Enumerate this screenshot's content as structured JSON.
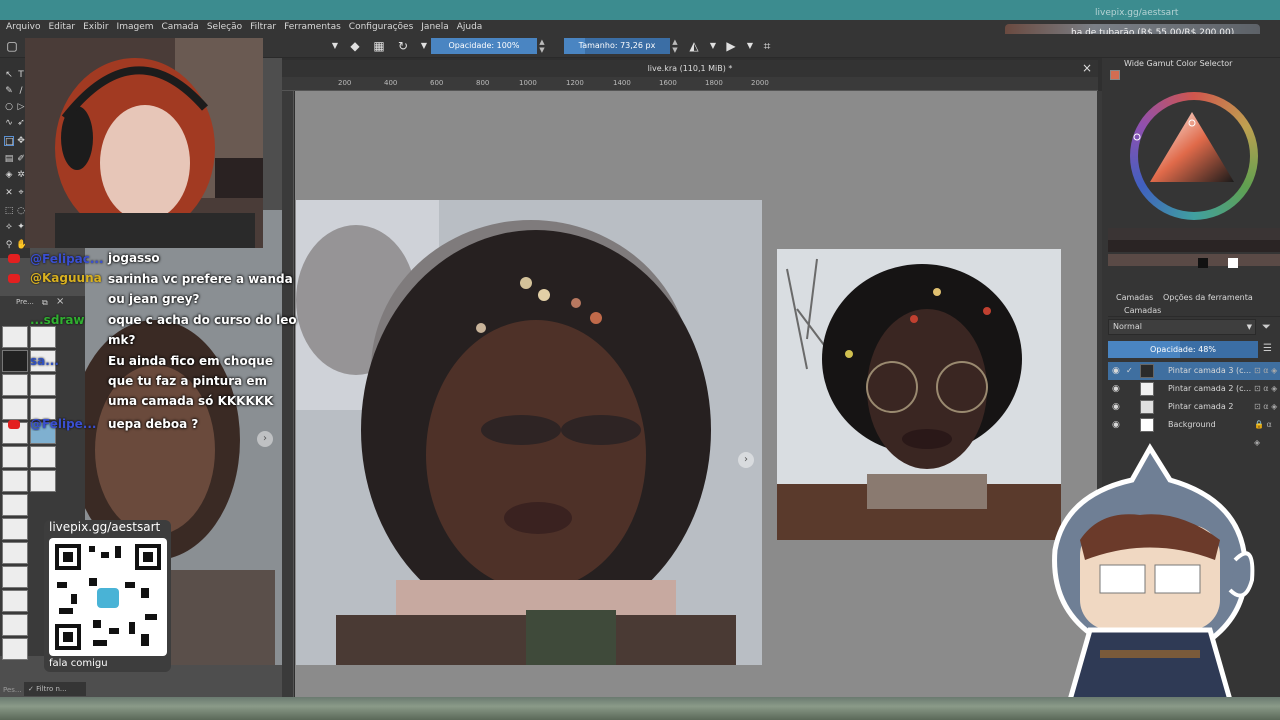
{
  "menubar": [
    "Arquivo",
    "Editar",
    "Exibir",
    "Imagem",
    "Camada",
    "Seleção",
    "Filtrar",
    "Ferramentas",
    "Configurações",
    "Janela",
    "Ajuda"
  ],
  "toolbar": {
    "opacity_label": "Opacidade: 100%",
    "opacity_value": 1.0,
    "size_label": "Tamanho: 73,26 px"
  },
  "document": {
    "tab_title": "live.kra (110,1 MiB) *",
    "close_icon": "×",
    "ruler_ticks": [
      "200",
      "400",
      "600",
      "800",
      "1000",
      "1200",
      "1400",
      "1600",
      "1800",
      "2000"
    ]
  },
  "overlay": {
    "donation_handle": "livepix.gg/aestsart",
    "donation_text": "ha de tubarão (R$ 55,00/R$ 200,00)",
    "qr_title": "livepix.gg/aestsart",
    "qr_caption": "fala comigu"
  },
  "chat": [
    {
      "user": "",
      "message": "jogasso",
      "platform": "none"
    },
    {
      "user": "@Felipac...",
      "message": "",
      "platform": "youtube"
    },
    {
      "user": "@Kaguuna",
      "message": "sarinha vc prefere a wanda ou jean grey?",
      "platform": "youtube"
    },
    {
      "user": "...sdraw",
      "message": "oque c acha do curso do leo mk?",
      "platform": "twitch"
    },
    {
      "user": "sa...",
      "message": "Eu ainda fico em choque que tu faz a pintura em uma camada só KKKKKK",
      "platform": "twitch"
    },
    {
      "user": "@Felipe...",
      "message": "uepa deboa ?",
      "platform": "youtube"
    }
  ],
  "left_panel": {
    "presets_title": "Pre...",
    "filter_label": "Filtro n...",
    "search_placeholder": "Pes..."
  },
  "right_dock": {
    "color_selector_title": "Wide Gamut Color Selector",
    "tabs": [
      "Camadas",
      "Opções da ferramenta"
    ],
    "layers_title": "Camadas",
    "blend_mode": "Normal",
    "opacity_label": "Opacidade: 48%",
    "opacity_value": 0.48,
    "layers": [
      {
        "name": "Pintar camada 3 (c...",
        "active": true,
        "visible": true
      },
      {
        "name": "Pintar camada 2 (c...",
        "active": false,
        "visible": true
      },
      {
        "name": "Pintar camada 2",
        "active": false,
        "visible": true
      },
      {
        "name": "Background",
        "active": false,
        "visible": true
      }
    ]
  },
  "icons": {
    "eraser": "eraser-icon",
    "reset": "reset-icon",
    "mirror": "mirror-icon",
    "wrap": "wrap-icon",
    "eye": "eye-icon",
    "filter": "filter-icon"
  }
}
